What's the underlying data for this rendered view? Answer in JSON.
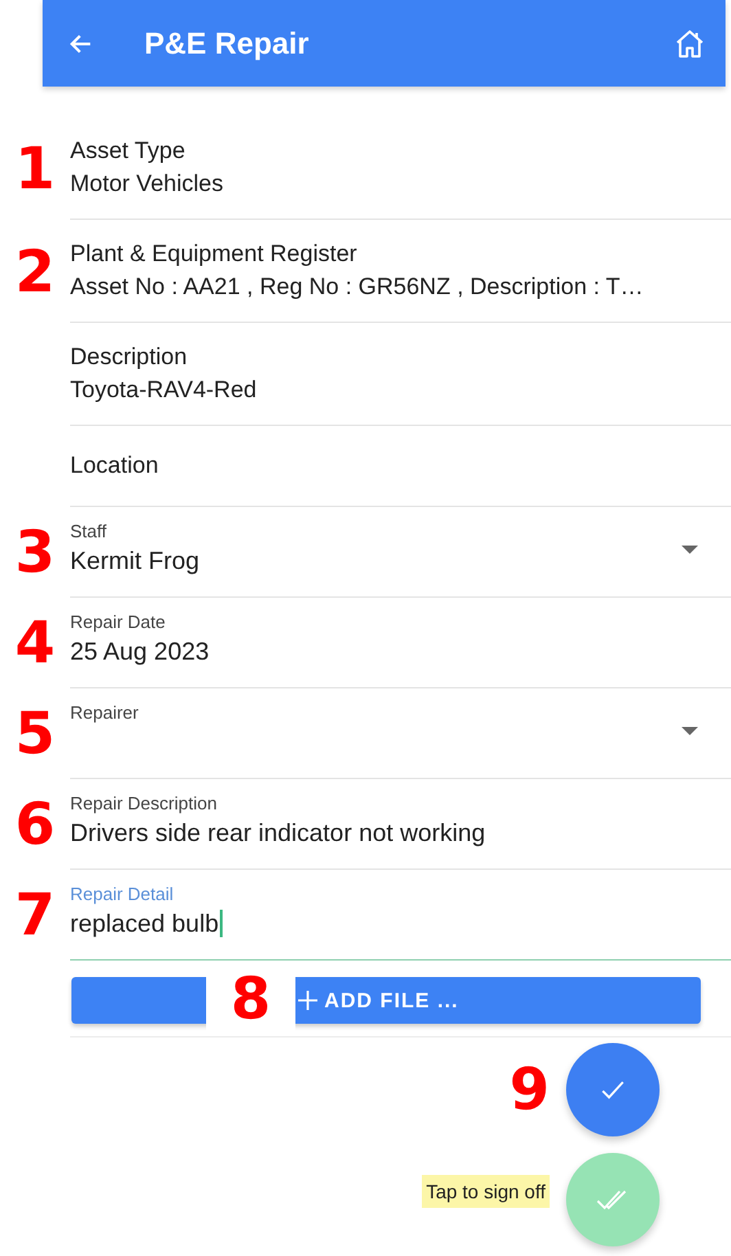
{
  "header": {
    "title": "P&E Repair"
  },
  "fields": [
    {
      "kind": "info",
      "label": "Asset Type",
      "value": "Motor Vehicles",
      "marker": "1"
    },
    {
      "kind": "info",
      "label": "Plant & Equipment Register",
      "value": "Asset No : AA21 , Reg No : GR56NZ , Description : T…",
      "marker": "2"
    },
    {
      "kind": "info",
      "label": "Description",
      "value": "Toyota-RAV4-Red"
    },
    {
      "kind": "info",
      "label": "Location"
    },
    {
      "kind": "select",
      "label": "Staff",
      "value": "Kermit Frog",
      "marker": "3",
      "focused": false
    },
    {
      "kind": "text",
      "label": "Repair Date",
      "value": "25 Aug 2023",
      "marker": "4",
      "focused": false
    },
    {
      "kind": "select",
      "label": "Repairer",
      "marker": "5",
      "focused": false
    },
    {
      "kind": "text",
      "label": "Repair Description",
      "value": "Drivers side rear indicator not working",
      "marker": "6",
      "focused": false
    },
    {
      "kind": "text",
      "label": "Repair Detail",
      "value": "replaced bulb",
      "marker": "7",
      "focused": true
    }
  ],
  "add_file": {
    "label": "ADD FILE ...",
    "marker": "8"
  },
  "actions": {
    "save_marker": "9",
    "sign_off_hint": "Tap to sign off"
  }
}
